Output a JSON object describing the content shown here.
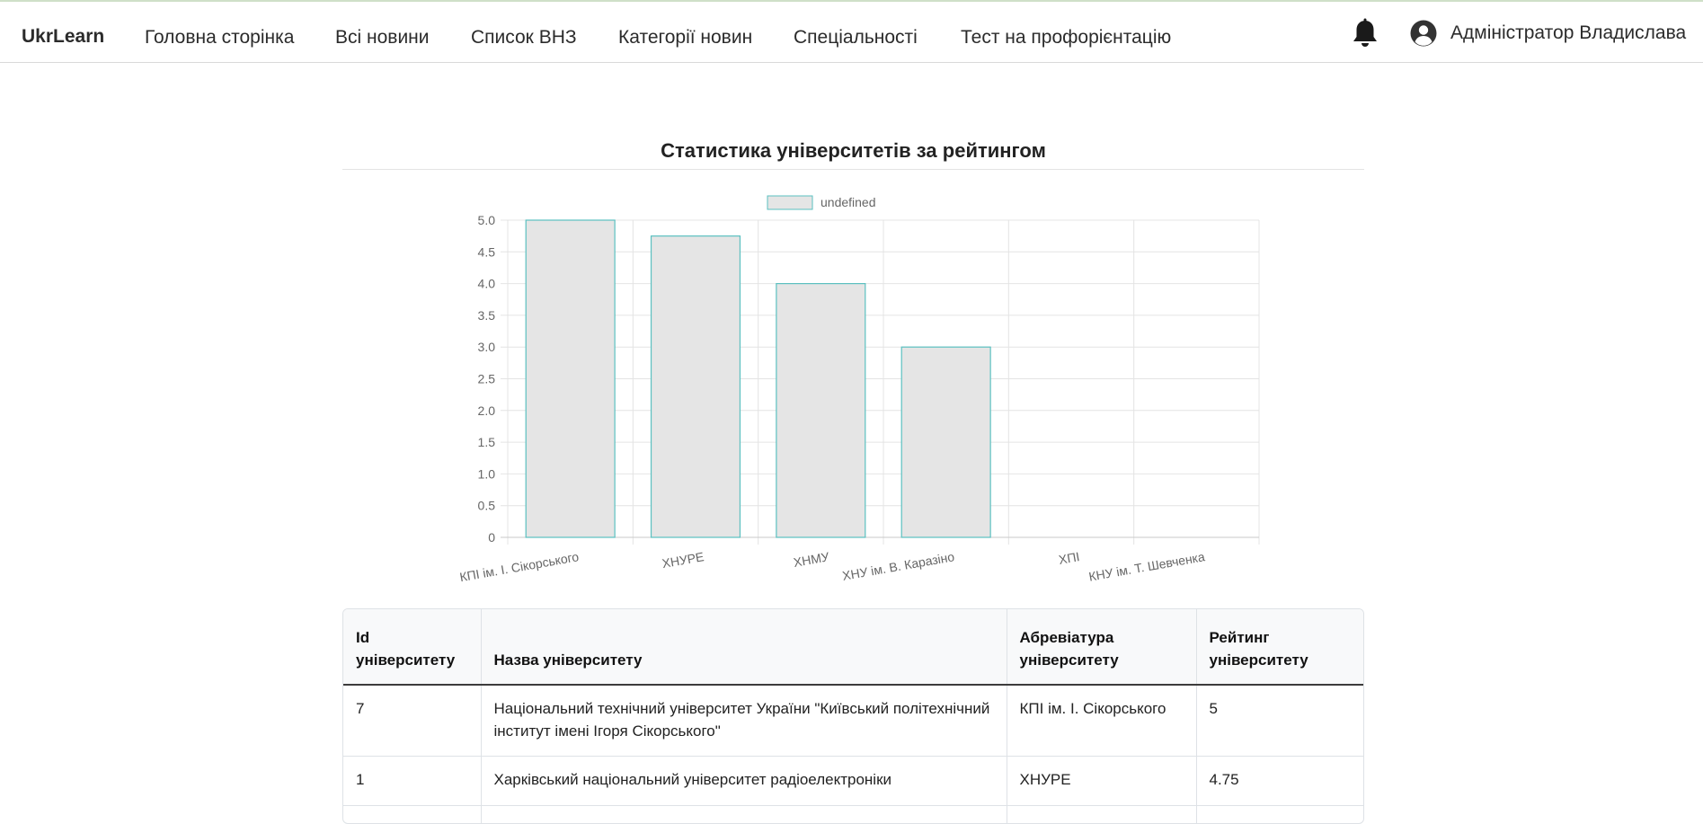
{
  "navbar": {
    "brand": "UkrLearn",
    "links": [
      "Головна сторінка",
      "Всі новини",
      "Список ВНЗ",
      "Категорії новин",
      "Спеціальності",
      "Тест на профорієнтацію"
    ],
    "bell_icon": "bell-icon",
    "user_icon": "user-circle-icon",
    "user_name": "Адміністратор Владислава"
  },
  "page": {
    "title": "Статистика університетів за рейтингом"
  },
  "chart_data": {
    "type": "bar",
    "legend": {
      "label": "undefined",
      "position": "top-center"
    },
    "categories": [
      "КПІ ім. І. Сікорського",
      "ХНУРЕ",
      "ХНМУ",
      "ХНУ ім. В. Каразіно",
      "ХПІ",
      "КНУ ім. Т. Шевченка"
    ],
    "values": [
      5,
      4.75,
      4,
      3,
      0,
      0
    ],
    "ylim": [
      0,
      5
    ],
    "yticks": [
      "5.0",
      "4.5",
      "4.0",
      "3.5",
      "3.0",
      "2.5",
      "2.0",
      "1.5",
      "1.0",
      "0.5",
      "0"
    ],
    "grid": true,
    "bar_fill": "#e5e5e5",
    "bar_border": "#5bc0c0"
  },
  "table": {
    "headers": [
      "Id університету",
      "Назва університету",
      "Абревіатура університету",
      "Рейтинг університету"
    ],
    "rows": [
      [
        "7",
        "Національний технічний університет України \"Київський політехнічний інститут імені Ігоря Сікорського\"",
        "КПІ ім. І. Сікорського",
        "5"
      ],
      [
        "1",
        "Харківський національний університет радіоелектроніки",
        "ХНУРЕ",
        "4.75"
      ],
      [
        "",
        "",
        "",
        ""
      ]
    ]
  }
}
